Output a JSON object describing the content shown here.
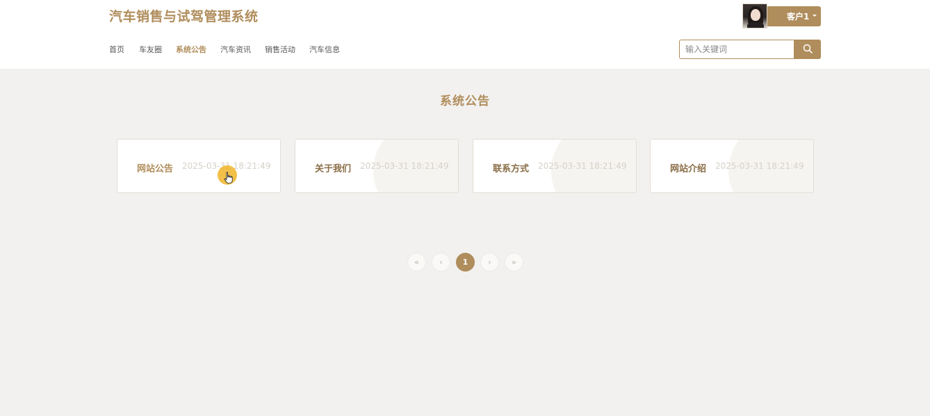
{
  "header": {
    "site_title": "汽车销售与试驾管理系统",
    "user_name": "客户1"
  },
  "nav": {
    "items": [
      {
        "label": "首页"
      },
      {
        "label": "车友圈"
      },
      {
        "label": "系统公告",
        "active": true
      },
      {
        "label": "汽车资讯"
      },
      {
        "label": "销售活动"
      },
      {
        "label": "汽车信息"
      }
    ]
  },
  "search": {
    "placeholder": "输入关键词"
  },
  "main": {
    "section_title": "系统公告",
    "cards": [
      {
        "title": "网站公告",
        "date": "2025-03-31 18:21:49"
      },
      {
        "title": "关于我们",
        "date": "2025-03-31 18:21:49"
      },
      {
        "title": "联系方式",
        "date": "2025-03-31 18:21:49"
      },
      {
        "title": "网站介绍",
        "date": "2025-03-31 18:21:49"
      }
    ]
  },
  "pagination": {
    "first": "«",
    "prev": "‹",
    "current": "1",
    "next": "›",
    "last": "»"
  },
  "colors": {
    "accent": "#b08d5c",
    "background": "#f2f1ef"
  }
}
